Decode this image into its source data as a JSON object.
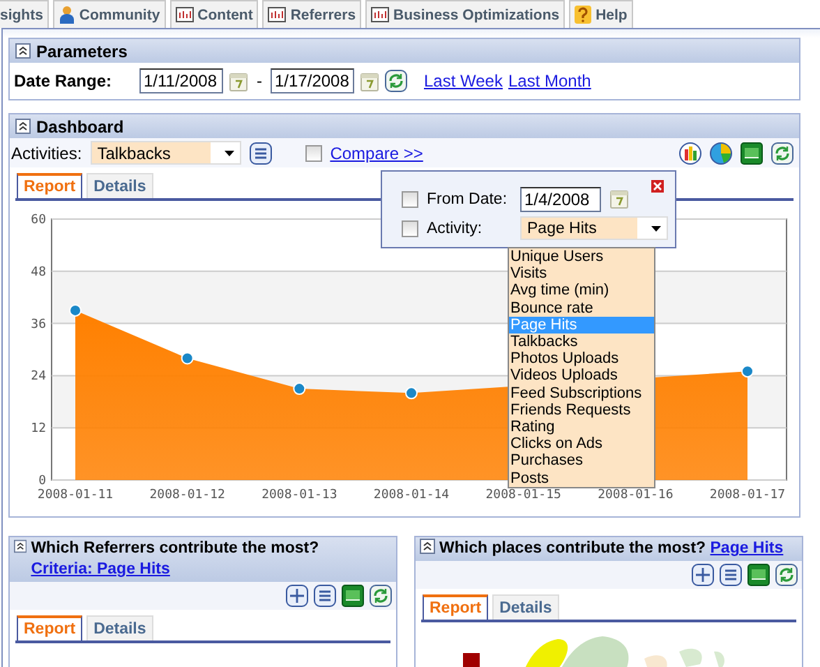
{
  "tabs": [
    {
      "label": "sights",
      "kind": "plain"
    },
    {
      "label": "Community",
      "kind": "person"
    },
    {
      "label": "Content",
      "kind": "chart"
    },
    {
      "label": "Referrers",
      "kind": "chart"
    },
    {
      "label": "Business Optimizations",
      "kind": "chart"
    },
    {
      "label": "Help",
      "kind": "help"
    }
  ],
  "parameters": {
    "title": "Parameters",
    "date_label": "Date Range:",
    "from": "1/11/2008",
    "separator": "-",
    "to": "1/17/2008",
    "links": [
      "Last Week",
      "Last Month"
    ]
  },
  "dashboard": {
    "title": "Dashboard",
    "activities_label": "Activities:",
    "activity": "Talkbacks",
    "compare": {
      "label": "Compare >>",
      "checked": false
    },
    "view_tabs": [
      {
        "label": "Report",
        "selected": true
      },
      {
        "label": "Details",
        "selected": false
      }
    ],
    "chart_data": {
      "type": "area",
      "categories": [
        "2008-01-11",
        "2008-01-12",
        "2008-01-13",
        "2008-01-14",
        "2008-01-15",
        "2008-01-16",
        "2008-01-17"
      ],
      "series": [
        {
          "color": "#ff8000",
          "values": [
            39,
            28,
            21,
            20,
            null,
            null,
            25
          ]
        }
      ],
      "ylim": [
        0,
        60
      ],
      "yticks": [
        0,
        12,
        24,
        36,
        48,
        60
      ],
      "grid": true
    }
  },
  "compare_popup": {
    "from_date": {
      "label": "From Date:",
      "checked": false,
      "value": "1/4/2008"
    },
    "activity": {
      "label": "Activity:",
      "checked": false,
      "value": "Page Hits"
    },
    "options": [
      {
        "label": "Unique Users",
        "selected": false
      },
      {
        "label": "Visits",
        "selected": false
      },
      {
        "label": "Avg time (min)",
        "selected": false
      },
      {
        "label": "Bounce rate",
        "selected": false
      },
      {
        "label": "Page Hits",
        "selected": true
      },
      {
        "label": "Talkbacks",
        "selected": false
      },
      {
        "label": "Photos Uploads",
        "selected": false
      },
      {
        "label": "Videos Uploads",
        "selected": false
      },
      {
        "label": "Feed Subscriptions",
        "selected": false
      },
      {
        "label": "Friends Requests",
        "selected": false
      },
      {
        "label": "Rating",
        "selected": false
      },
      {
        "label": "Clicks on Ads",
        "selected": false
      },
      {
        "label": "Purchases",
        "selected": false
      },
      {
        "label": "Posts",
        "selected": false
      }
    ]
  },
  "panels": [
    {
      "title": "Which Referrers contribute the most?",
      "link": "Criteria: Page Hits",
      "tabs": [
        {
          "label": "Report",
          "selected": true
        },
        {
          "label": "Details",
          "selected": false
        }
      ]
    },
    {
      "title": "Which places contribute the most?",
      "link": "Page Hits",
      "tabs": [
        {
          "label": "Report",
          "selected": true
        },
        {
          "label": "Details",
          "selected": false
        }
      ]
    }
  ]
}
